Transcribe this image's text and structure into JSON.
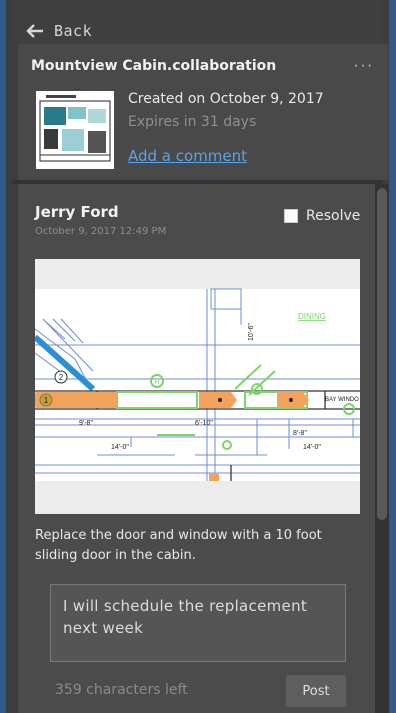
{
  "nav": {
    "back_label": "Back"
  },
  "collaboration": {
    "title": "Mountview Cabin.collaboration",
    "more_label": "···",
    "created": "Created on October 9, 2017",
    "expires": "Expires in 31 days",
    "add_comment": "Add a comment"
  },
  "comment": {
    "author": "Jerry Ford",
    "timestamp": "October 9, 2017 12:49 PM",
    "resolve_label": "Resolve",
    "resolved": false,
    "text": "Replace the door and window with a 10 foot sliding door in the cabin.",
    "plan_labels": {
      "dining": "DINING",
      "bay_window": "BAY WINDO",
      "dim_10_6": "10'-6\"",
      "dim_9_8": "9'-8\"",
      "dim_6_10": "6'-10\"",
      "dim_14_0a": "14'-0\"",
      "dim_8_8": "8'-8\"",
      "dim_14_0b": "14'-0\"",
      "marker_2": "2",
      "marker_h": "H",
      "marker_1": "1"
    }
  },
  "reply": {
    "value": "I will schedule the replacement next week",
    "chars_left": "359 characters left",
    "post_label": "Post"
  },
  "colors": {
    "accent_blue": "#2f5b86",
    "link": "#5aa3e6",
    "markup_orange": "#f2a25a",
    "markup_green": "#7ed36a"
  }
}
